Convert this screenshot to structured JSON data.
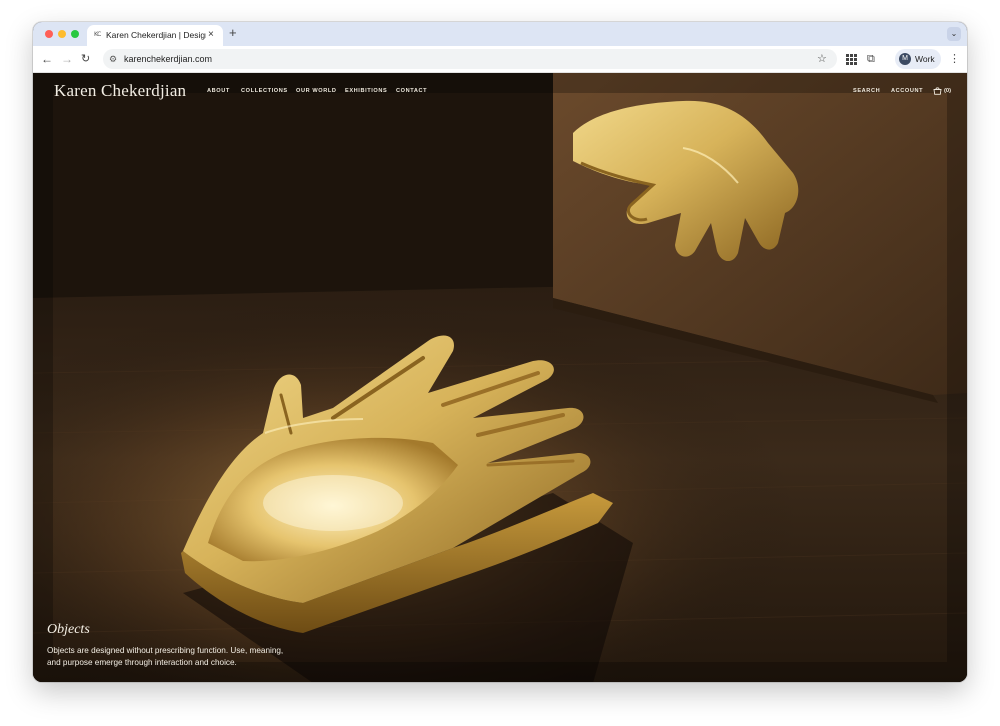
{
  "browser": {
    "tab": {
      "favicon_text": "KC",
      "title": "Karen Chekerdjian | Design | Beirut",
      "close_glyph": "×"
    },
    "new_tab_glyph": "+",
    "tabs_menu_glyph": "⌄",
    "nav": {
      "back": "←",
      "forward": "→",
      "reload": "↻"
    },
    "site_info_glyph": "⚙",
    "url": "karenchekerdjian.com",
    "bookmark_glyph": "☆",
    "extensions_glyph": "⧉",
    "profile": {
      "initial": "M",
      "label": "Work"
    },
    "menu_glyph": "⋮"
  },
  "site": {
    "logo": "Karen Chekerdjian",
    "nav_links": {
      "about": "ABOUT",
      "collections": "COLLECTIONS",
      "our_world": "OUR WORLD",
      "exhibitions": "EXHIBITIONS",
      "contact": "CONTACT"
    },
    "utility_links": {
      "search": "SEARCH",
      "account": "ACCOUNT",
      "cart_count": "(0)"
    }
  },
  "hero": {
    "title": "Objects",
    "description_line_1": "Objects are designed without prescribing function. Use, meaning,",
    "description_line_2": "and purpose emerge through interaction and choice."
  },
  "colors": {
    "accent_gold": "#c9a54a",
    "tab_strip": "#dde5f4",
    "nav_text": "#efe9dd",
    "backdrop": "#1a120b"
  }
}
